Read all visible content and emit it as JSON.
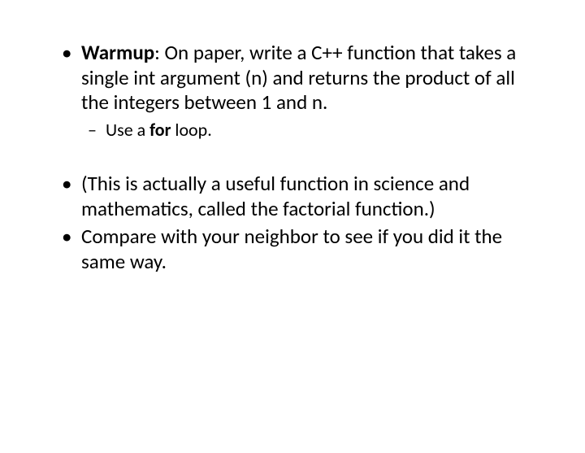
{
  "slide": {
    "bullets": [
      {
        "pre_bold": "Warmup",
        "post_bold": ": On paper, write a C++ function that takes a single int argument (n) and returns the product of all the integers between 1 and n.",
        "sub": {
          "pre": "Use a ",
          "bold": "for",
          "post": " loop."
        }
      },
      {
        "text": "(This is actually a useful function in science and mathematics, called the factorial function.)"
      },
      {
        "text": "Compare with your neighbor to see if you did it the same way."
      }
    ]
  }
}
